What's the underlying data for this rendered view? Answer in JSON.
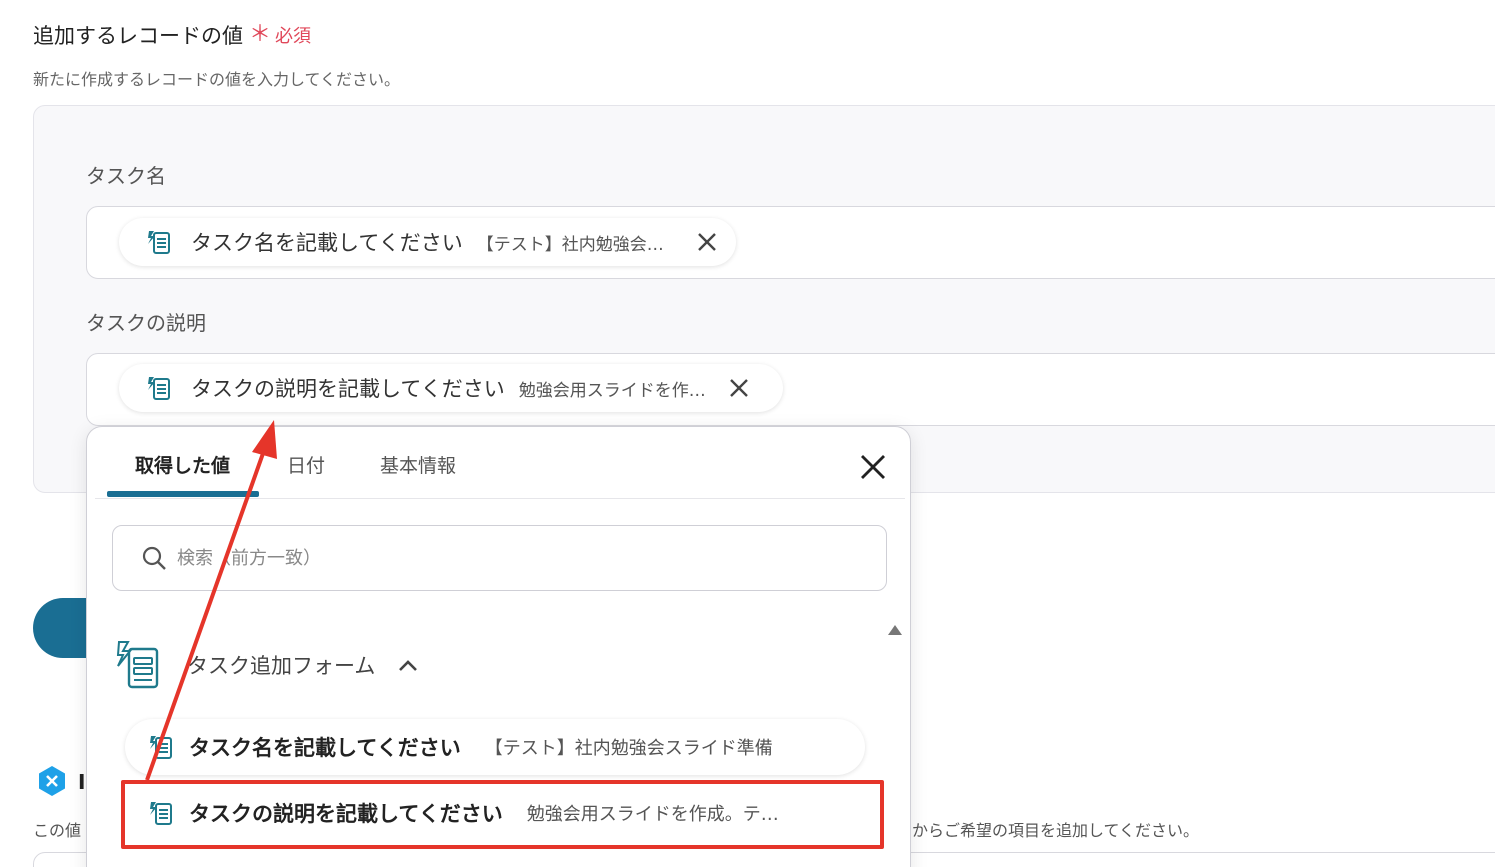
{
  "section": {
    "title": "追加するレコードの値",
    "required_label": "必須",
    "required_star": "＊",
    "description": "新たに作成するレコードの値を入力してください。"
  },
  "fields": [
    {
      "label": "タスク名",
      "chip_key": "タスク名を記載してください",
      "chip_value": "【テスト】社内勉強会スライド準備"
    },
    {
      "label": "タスクの説明",
      "chip_key": "タスクの説明を記載してください",
      "chip_value": "勉強会用スライドを作成。テ…"
    }
  ],
  "popover": {
    "tabs": [
      "取得した値",
      "日付",
      "基本情報"
    ],
    "search_placeholder": "検索（前方一致）",
    "group_label": "タスク追加フォーム",
    "options": [
      {
        "key": "タスク名を記載してください",
        "value": "【テスト】社内勉強会スライド準備"
      },
      {
        "key": "タスクの説明を記載してください",
        "value": "勉強会用スライドを作成。テ…"
      }
    ]
  },
  "background": {
    "heading_fragment": "I",
    "desc_left": "この値",
    "desc_right": "からご希望の項目を追加してください。"
  },
  "colors": {
    "accent": "#1a6e93",
    "required": "#e0485a",
    "highlight": "#e5352a",
    "icon": "#1f7a8c",
    "badge": "#1ea1e8"
  }
}
